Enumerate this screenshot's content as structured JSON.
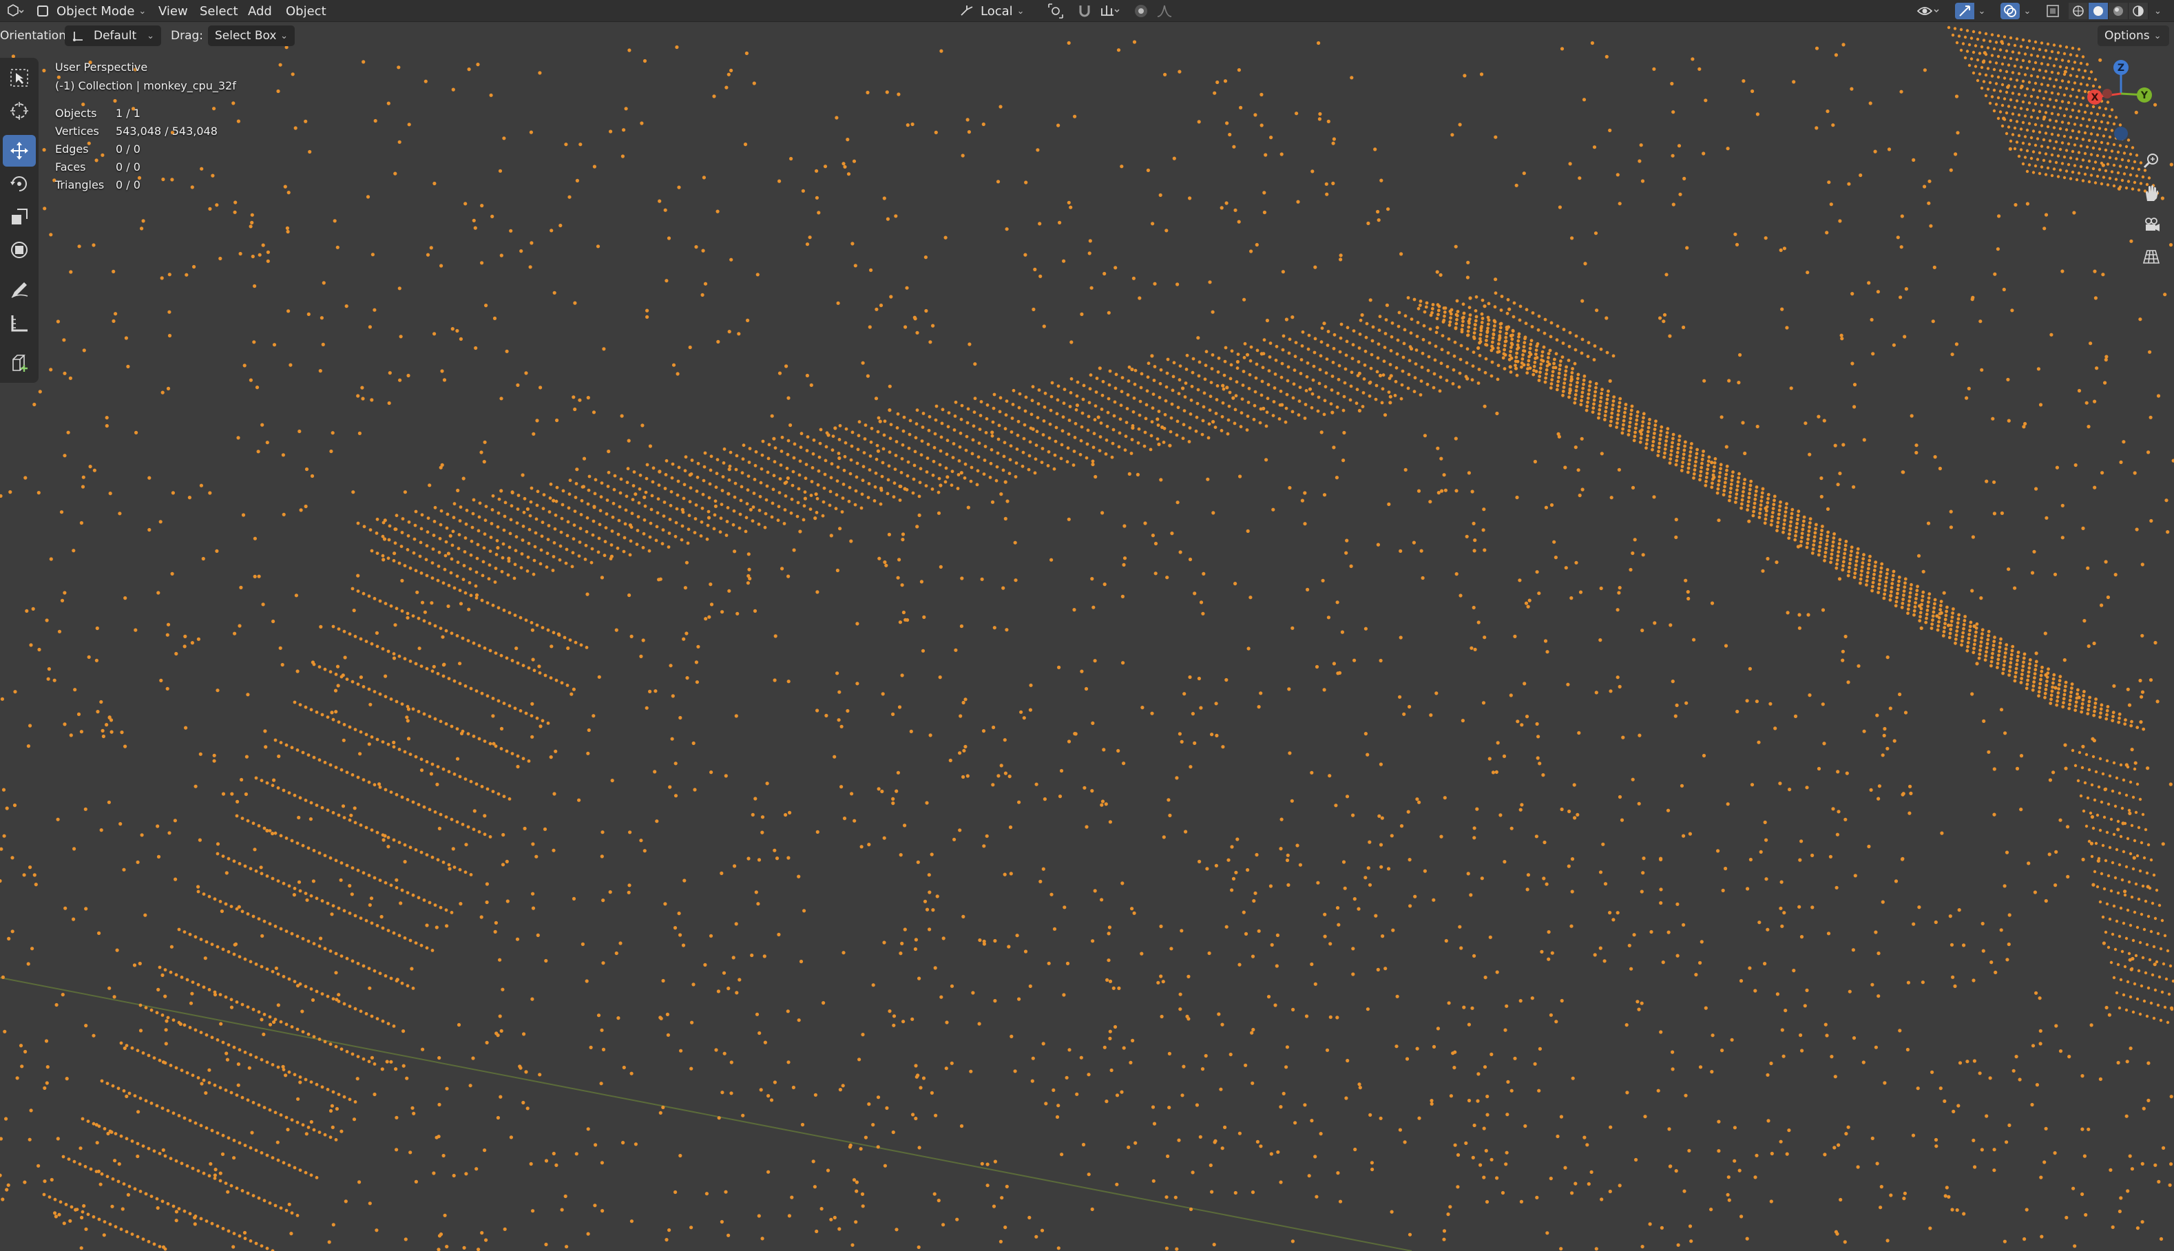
{
  "header": {
    "editor_type_icon": "viewport-editor-icon",
    "mode": "Object Mode",
    "menus": [
      "View",
      "Select",
      "Add",
      "Object"
    ],
    "transform_orientation": "Local",
    "pivot_icon": "pivot-icon",
    "snap_icon": "snap-magnet-icon",
    "snap_target_icon": "snap-increment-icon",
    "proportional_icon": "proportional-edit-icon",
    "falloff_icon": "falloff-icon",
    "right_icons": [
      "visibility-eye-icon",
      "gizmo-icon",
      "overlay-icon",
      "xray-icon",
      "wireframe-shading-icon",
      "solid-shading-icon",
      "material-shading-icon",
      "rendered-shading-icon"
    ]
  },
  "toolbar": {
    "orientation_label": "Orientation:",
    "orientation_value": "Default",
    "drag_label": "Drag:",
    "drag_value": "Select Box",
    "options_label": "Options"
  },
  "overlay": {
    "view_name": "User Perspective",
    "collection": "(-1) Collection | monkey_cpu_32f",
    "stats": [
      {
        "label": "Objects",
        "value": "1 / 1"
      },
      {
        "label": "Vertices",
        "value": "543,048 / 543,048"
      },
      {
        "label": "Edges",
        "value": "0 / 0"
      },
      {
        "label": "Faces",
        "value": "0 / 0"
      },
      {
        "label": "Triangles",
        "value": "0 / 0"
      }
    ]
  },
  "gizmo": {
    "x_label": "X",
    "y_label": "Y",
    "z_label": "Z"
  },
  "colors": {
    "vertex": "#e8922e",
    "background": "#3d3d3d",
    "header": "#303030",
    "accent": "#4772b3",
    "axis_x": "#e8453c",
    "axis_y": "#7bb42a",
    "axis_z": "#3f7bd4"
  }
}
